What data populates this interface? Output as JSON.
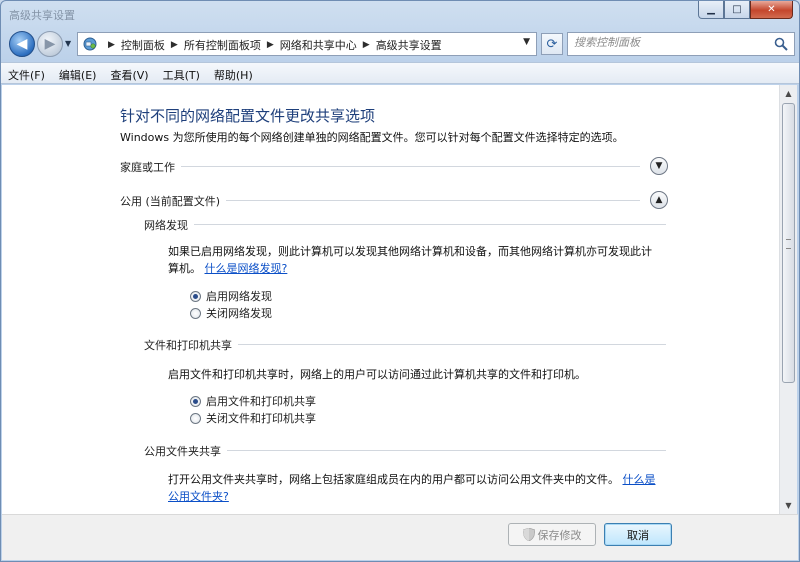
{
  "window": {
    "title": "高级共享设置"
  },
  "navigation": {
    "breadcrumbs": [
      "控制面板",
      "所有控制面板项",
      "网络和共享中心",
      "高级共享设置"
    ],
    "search_placeholder": "搜索控制面板"
  },
  "menu": {
    "items": [
      "文件(F)",
      "编辑(E)",
      "查看(V)",
      "工具(T)",
      "帮助(H)"
    ]
  },
  "page": {
    "heading": "针对不同的网络配置文件更改共享选项",
    "subtitle": "Windows 为您所使用的每个网络创建单独的网络配置文件。您可以针对每个配置文件选择特定的选项。",
    "profiles": [
      {
        "label": "家庭或工作",
        "expanded": false
      },
      {
        "label": "公用 (当前配置文件)",
        "expanded": true
      }
    ],
    "network_discovery": {
      "title": "网络发现",
      "description": "如果已启用网络发现，则此计算机可以发现其他网络计算机和设备，而其他网络计算机亦可发现此计算机。",
      "link": "什么是网络发现?",
      "options": [
        "启用网络发现",
        "关闭网络发现"
      ],
      "selected": 0
    },
    "file_printer_sharing": {
      "title": "文件和打印机共享",
      "description": "启用文件和打印机共享时，网络上的用户可以访问通过此计算机共享的文件和打印机。",
      "options": [
        "启用文件和打印机共享",
        "关闭文件和打印机共享"
      ],
      "selected": 0
    },
    "public_folder_sharing": {
      "title": "公用文件夹共享",
      "description": "打开公用文件夹共享时，网络上包括家庭组成员在内的用户都可以访问公用文件夹中的文件。",
      "link": "什么是公用文件夹?"
    }
  },
  "footer": {
    "save_label": "保存修改",
    "cancel_label": "取消"
  },
  "colors": {
    "heading": "#1e3f7b",
    "link": "#0b4fc7",
    "cancel_accent": "#3c7fb1"
  }
}
